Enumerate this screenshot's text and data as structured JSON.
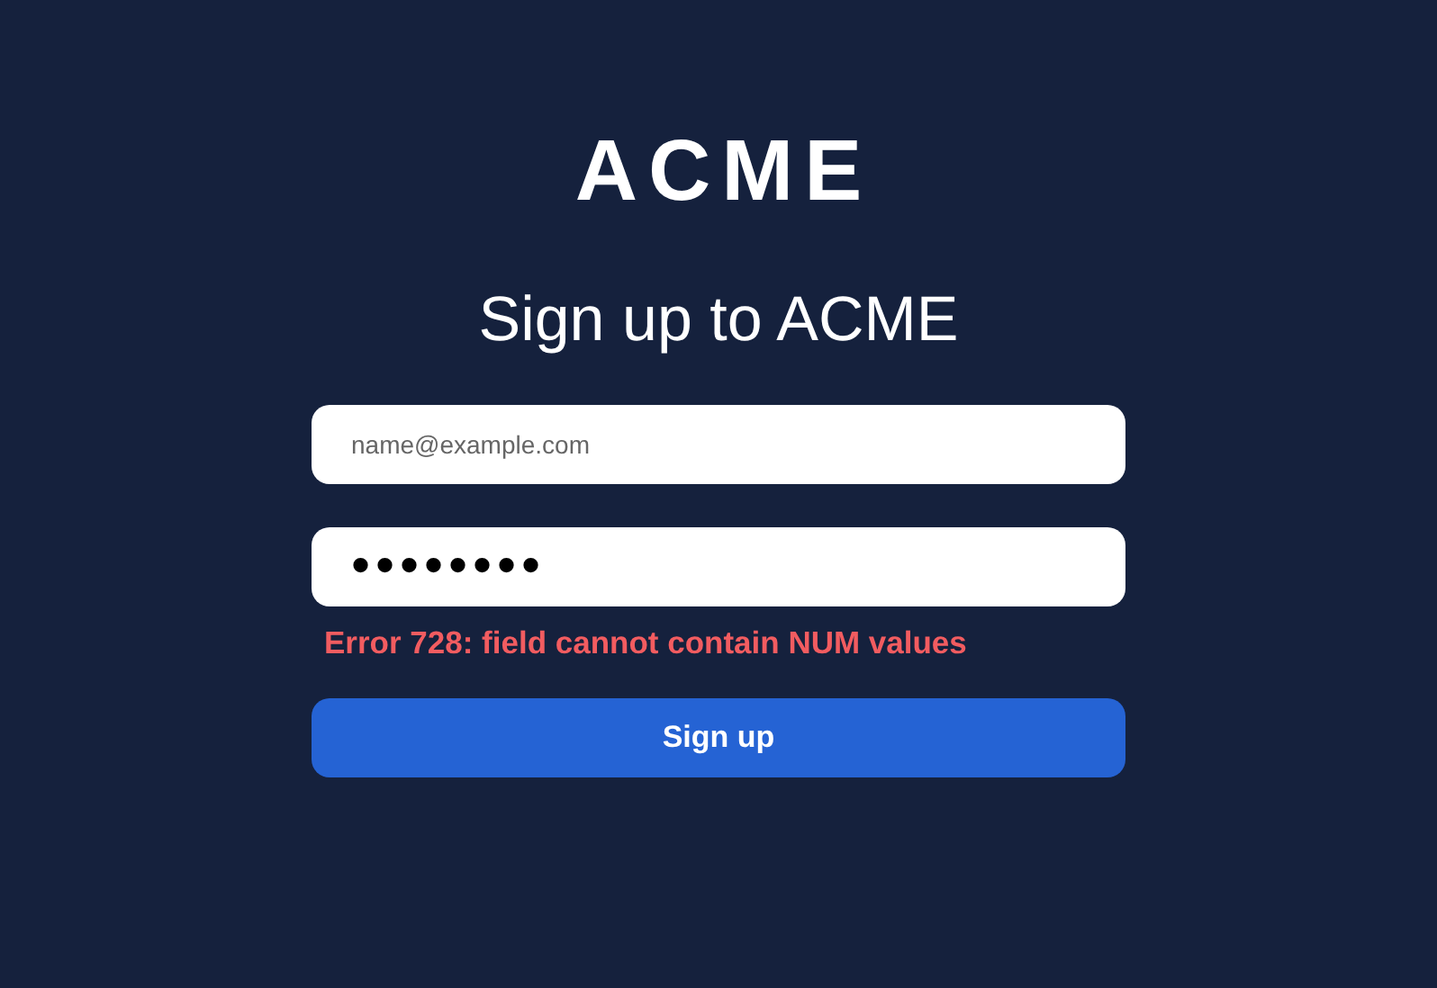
{
  "logo": "ACME",
  "heading": "Sign up to ACME",
  "email_field": {
    "placeholder": "name@example.com"
  },
  "password_field": {
    "value": "••••••••",
    "error": "Error 728: field cannot contain NUM values"
  },
  "submit_button": {
    "label": "Sign up"
  }
}
